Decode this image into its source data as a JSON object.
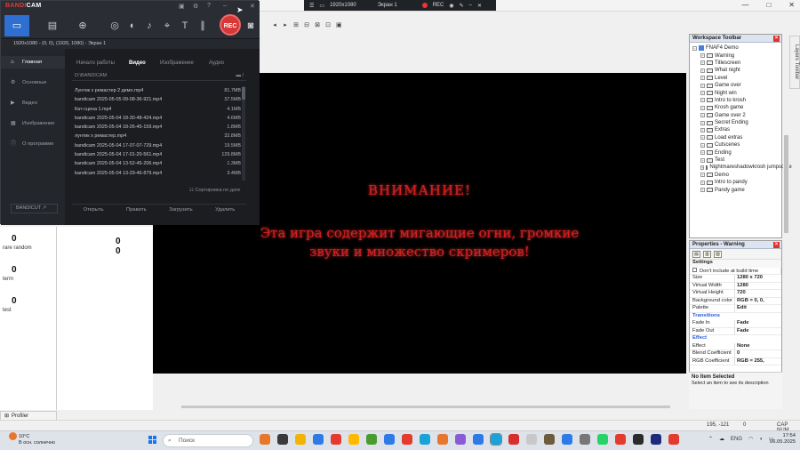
{
  "app": {
    "rec_strip": {
      "resolution": "1920x1080",
      "screen": "Экран 1",
      "rec": "REC"
    },
    "window_controls": {
      "min": "—",
      "max": "□",
      "close": "✕"
    }
  },
  "toolbar": {
    "items": [
      "◂",
      "▸",
      "⊞",
      "⊟",
      "⊠",
      "⊡",
      "▣"
    ]
  },
  "left_pane": {
    "counters": [
      {
        "value": "0",
        "label": "rare random"
      },
      {
        "value": "0",
        "label": "term"
      },
      {
        "value": "0",
        "label": "test"
      }
    ],
    "mid_values": [
      "0",
      "0"
    ]
  },
  "game": {
    "title": "ВНИМАНИЕ!",
    "line1": "Эта игра содержит мигающие огни, громкие",
    "line2": "звуки и множество скримеров!"
  },
  "profiler": {
    "label": "Profiler"
  },
  "status": {
    "coords": "195, -121",
    "zero": "0",
    "caps": "CAP NUM"
  },
  "workspace": {
    "title": "Workspace Toolbar",
    "root": "FNAF4 Demo",
    "items": [
      "Warning",
      "Titlescreen",
      "What night",
      "Level",
      "Game over",
      "Night win",
      "Intro to krosh",
      "Krosh game",
      "Game over 2",
      "Secret Ending",
      "Extras",
      "Load extras",
      "Cutscenes",
      "Ending",
      "Test",
      "Nightmareshadowkrosh jumpscare",
      "Demo",
      "Intro to pandy",
      "Pandy game"
    ]
  },
  "side_tab": "Layers Toolbar",
  "properties": {
    "title": "Properties - Warning",
    "section_settings": "Settings",
    "dont_include": "Don't include at build time",
    "rows": [
      {
        "k": "Size",
        "v": "1280 x 720"
      },
      {
        "k": "Virtual Width",
        "v": "1280"
      },
      {
        "k": "Virtual Height",
        "v": "720"
      },
      {
        "k": "Background color",
        "v": "RGB = 0, 0,"
      },
      {
        "k": "Palette",
        "v": "Edit"
      }
    ],
    "section_transitions": "Transitions",
    "trans_rows": [
      {
        "k": "Fade In",
        "v": "Fade"
      },
      {
        "k": "Fade Out",
        "v": "Fade"
      }
    ],
    "section_effect": "Effect",
    "effect_rows": [
      {
        "k": "Effect",
        "v": "None"
      },
      {
        "k": "Blend Coefficient",
        "v": "0"
      },
      {
        "k": "RGB Coefficient",
        "v": "RGB = 255,"
      }
    ],
    "no_item": "No Item Selected",
    "no_item_hint": "Select an item to see its description"
  },
  "bandicam": {
    "logo_a": "BANDI",
    "logo_b": "CAM",
    "rec": "REC",
    "info": "1920x1080 - (0, 0), (1920, 1080) - Экран 1",
    "nav": [
      {
        "label": "Главная",
        "icon": "⌂"
      },
      {
        "label": "Основные",
        "icon": "⚙"
      },
      {
        "label": "Видео",
        "icon": "▶"
      },
      {
        "label": "Изображение",
        "icon": "▦"
      },
      {
        "label": "О программе",
        "icon": "ⓘ"
      }
    ],
    "bandicut": "BANDICUT ↗",
    "tabs": [
      "Начало работы",
      "Видео",
      "Изображение",
      "Аудио"
    ],
    "path": "D:\\BANDICAM",
    "files": [
      {
        "n": "Лунтик х ремастер 2 демо.mp4",
        "s": "81.7MB"
      },
      {
        "n": "bandicam 2025-05-05 09-08-36-921.mp4",
        "s": "37.5MB"
      },
      {
        "n": "Кат-сцена 1.mp4",
        "s": "4.1MB"
      },
      {
        "n": "bandicam 2025-05-04 18-30-48-424.mp4",
        "s": "4.6MB"
      },
      {
        "n": "bandicam 2025-05-04 18-26-45-159.mp4",
        "s": "1.8MB"
      },
      {
        "n": "лунтик х ремастер.mp4",
        "s": "32.8MB"
      },
      {
        "n": "bandicam 2025-05-04 17-07-07-729.mp4",
        "s": "19.5MB"
      },
      {
        "n": "bandicam 2025-05-04 17-01-20-561.mp4",
        "s": "129.8MB"
      },
      {
        "n": "bandicam 2025-05-04 13-52-45-206.mp4",
        "s": "1.3MB"
      },
      {
        "n": "bandicam 2025-05-04 13-29-46-879.mp4",
        "s": "3.4MB"
      }
    ],
    "sort": "Сортировка по дате",
    "buttons": [
      "Открыть",
      "Править",
      "Загрузить",
      "Удалить"
    ]
  },
  "taskbar": {
    "weather_temp": "10°C",
    "weather_desc": "В осн. солнечно",
    "search": "Поиск",
    "lang": "ENG",
    "time": "17:54",
    "date": "06.05.2025",
    "colors": [
      "#e8772e",
      "#3a3a3a",
      "#f2b400",
      "#2e7be8",
      "#e43b2e",
      "#ffb900",
      "#4a9c2e",
      "#2e7be8",
      "#e43b2e",
      "#1aa3d9",
      "#e8772e",
      "#8a5bd6",
      "#2e7be8",
      "#1aa3d9",
      "#d92e2e",
      "#c8c8c8",
      "#6d5b3e",
      "#2e7be8",
      "#777777",
      "#25d366",
      "#e43b2e",
      "#2b2b2b",
      "#1f2b7a",
      "#e43b2e"
    ]
  }
}
